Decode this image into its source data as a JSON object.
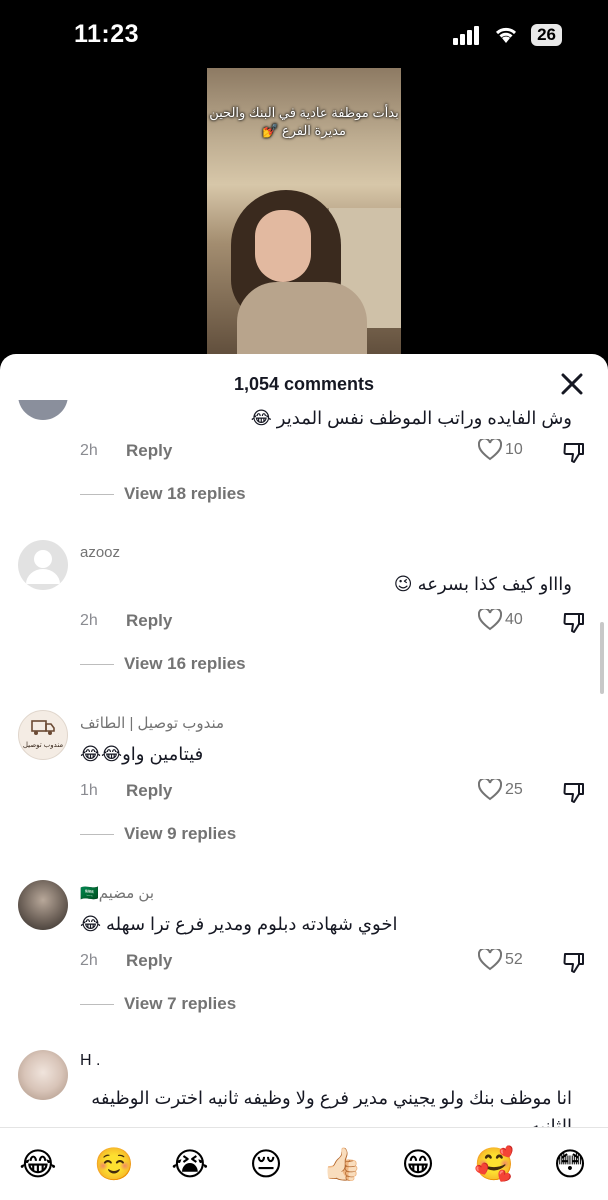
{
  "status_bar": {
    "time": "11:23",
    "battery": "26"
  },
  "video": {
    "caption_line1": "بدأت موظفة عادية في البنك والحين",
    "caption_line2": "مديرة الفرع 💅"
  },
  "sheet": {
    "title": "1,054 comments"
  },
  "comments": [
    {
      "username": "",
      "text": "وش الفايده وراتب الموظف نفس المدير 😂",
      "time": "2h",
      "reply_label": "Reply",
      "likes": "10",
      "view_replies": "View 18 replies"
    },
    {
      "username": "azooz",
      "text": "واااو كيف كذا بسرعه 😉",
      "time": "2h",
      "reply_label": "Reply",
      "likes": "40",
      "view_replies": "View 16 replies"
    },
    {
      "username": "مندوب توصيل | الطائف",
      "avatar_text": "مندوب توصيل",
      "text": "فيتامين واو😂😂",
      "time": "1h",
      "reply_label": "Reply",
      "likes": "25",
      "view_replies": "View 9 replies"
    },
    {
      "username": "بن مضيم🇸🇦",
      "text": "اخوي شهادته دبلوم ومدير فرع ترا سهله 😂",
      "time": "2h",
      "reply_label": "Reply",
      "likes": "52",
      "view_replies": "View 7 replies"
    },
    {
      "username": "H .",
      "text": "انا موظف بنك ولو يجيني مدير فرع ولا وظيفه ثانيه اخترت الوظيفه الثانيه"
    }
  ],
  "emoji_bar": [
    "😂",
    "☺️",
    "😭",
    "😔",
    "👍🏻",
    "😁",
    "🥰",
    "😳"
  ]
}
